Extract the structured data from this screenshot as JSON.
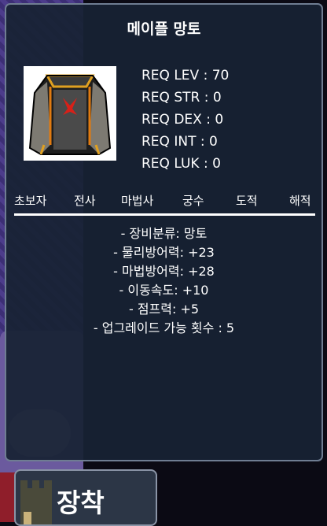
{
  "item": {
    "name": "메이플 망토",
    "icon": "cape-icon"
  },
  "requirements": [
    {
      "label": "REQ LEV",
      "value": "70"
    },
    {
      "label": "REQ STR",
      "value": "0"
    },
    {
      "label": "REQ DEX",
      "value": "0"
    },
    {
      "label": "REQ INT",
      "value": "0"
    },
    {
      "label": "REQ LUK",
      "value": "0"
    }
  ],
  "jobs": [
    "초보자",
    "전사",
    "마법사",
    "궁수",
    "도적",
    "해적"
  ],
  "stats": [
    "- 장비분류: 망토",
    "- 물리방어력: +23",
    "- 마법방어력: +28",
    "- 이동속도: +10",
    "- 점프력: +5",
    "- 업그레이드 가능 횟수 : 5"
  ],
  "equip_button": {
    "label": "장착"
  },
  "colors": {
    "panel": "#182234",
    "text": "#ffffff",
    "border": "#6f7d92"
  }
}
